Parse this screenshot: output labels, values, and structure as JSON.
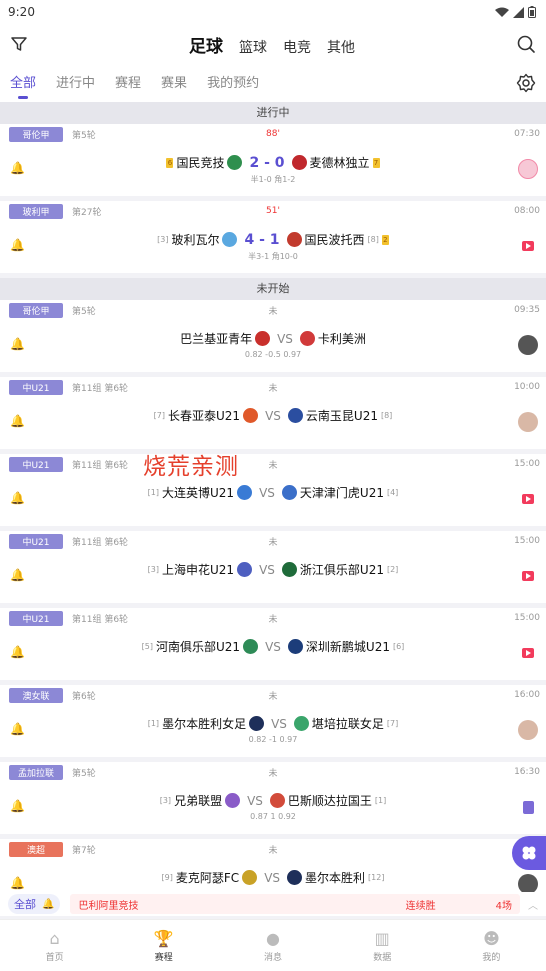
{
  "status": {
    "time": "9:20"
  },
  "sport_tabs": [
    "足球",
    "篮球",
    "电竞",
    "其他"
  ],
  "filter_tabs": [
    "全部",
    "进行中",
    "赛程",
    "赛果",
    "我的预约"
  ],
  "sections": {
    "live": "进行中",
    "upcoming": "未开始"
  },
  "watermark": "烧荒亲测",
  "matches": [
    {
      "league": "哥伦甲",
      "round": "第5轮",
      "mid": "88'",
      "time": "07:30",
      "home": "国民竞技",
      "away": "麦德林独立",
      "home_pre": "",
      "away_post": "",
      "home_card": "6",
      "away_card": "7",
      "score": "2 - 0",
      "sub": "半1-0  角1-2",
      "right": "avatar-pink"
    },
    {
      "league": "玻利甲",
      "round": "第27轮",
      "mid": "51'",
      "time": "08:00",
      "home": "玻利瓦尔",
      "away": "国民波托西",
      "home_pre": "[3]",
      "away_post": "[8]",
      "home_card": "",
      "away_card": "2",
      "score": "4 - 1",
      "sub": "半3-1  角10-0",
      "right": "play"
    },
    {
      "league": "哥伦甲",
      "round": "第5轮",
      "mid": "未",
      "time": "09:35",
      "home": "巴兰基亚青年",
      "away": "卡利美洲",
      "home_pre": "",
      "away_post": "",
      "score": "VS",
      "sub": "0.82  -0.5  0.97",
      "right": "avatar-dark"
    },
    {
      "league": "中U21",
      "round": "第11组 第6轮",
      "mid": "未",
      "time": "10:00",
      "home": "长春亚泰U21",
      "away": "云南玉昆U21",
      "home_pre": "[7]",
      "away_post": "[8]",
      "score": "VS",
      "sub": "",
      "right": "avatar"
    },
    {
      "league": "中U21",
      "round": "第11组 第6轮",
      "mid": "未",
      "time": "15:00",
      "home": "大连英博U21",
      "away": "天津津门虎U21",
      "home_pre": "[1]",
      "away_post": "[4]",
      "score": "VS",
      "sub": "",
      "right": "play"
    },
    {
      "league": "中U21",
      "round": "第11组 第6轮",
      "mid": "未",
      "time": "15:00",
      "home": "上海申花U21",
      "away": "浙江俱乐部U21",
      "home_pre": "[3]",
      "away_post": "[2]",
      "score": "VS",
      "sub": "",
      "right": "play"
    },
    {
      "league": "中U21",
      "round": "第11组 第6轮",
      "mid": "未",
      "time": "15:00",
      "home": "河南俱乐部U21",
      "away": "深圳新鹏城U21",
      "home_pre": "[5]",
      "away_post": "[6]",
      "score": "VS",
      "sub": "",
      "right": "play"
    },
    {
      "league": "澳女联",
      "round": "第6轮",
      "mid": "未",
      "time": "16:00",
      "home": "墨尔本胜利女足",
      "away": "堪培拉联女足",
      "home_pre": "[1]",
      "away_post": "[7]",
      "score": "VS",
      "sub": "0.82  -1  0.97",
      "right": "avatar"
    },
    {
      "league": "孟加拉联",
      "round": "第5轮",
      "mid": "未",
      "time": "16:30",
      "home": "兄弟联盟",
      "away": "巴斯顺达拉国王",
      "home_pre": "[3]",
      "away_post": "[1]",
      "score": "VS",
      "sub": "0.87  1  0.92",
      "right": "doc"
    },
    {
      "league": "澳超",
      "round": "第7轮",
      "mid": "未",
      "time": "",
      "home": "麦克阿瑟FC",
      "away": "墨尔本胜利",
      "home_pre": "[9]",
      "away_post": "[12]",
      "score": "VS",
      "sub": "",
      "right": "avatar-dark",
      "league_color": "red"
    }
  ],
  "ticker": {
    "all": "全部",
    "team": "巴利阿里竞技",
    "tag": "连续胜",
    "count": "4场"
  },
  "bottom_tabs": [
    "首页",
    "赛程",
    "消息",
    "数据",
    "我的"
  ],
  "colors": {
    "accent": "#5a4fd1",
    "live_red": "#e33333",
    "league_badge": "#8c88d6"
  }
}
